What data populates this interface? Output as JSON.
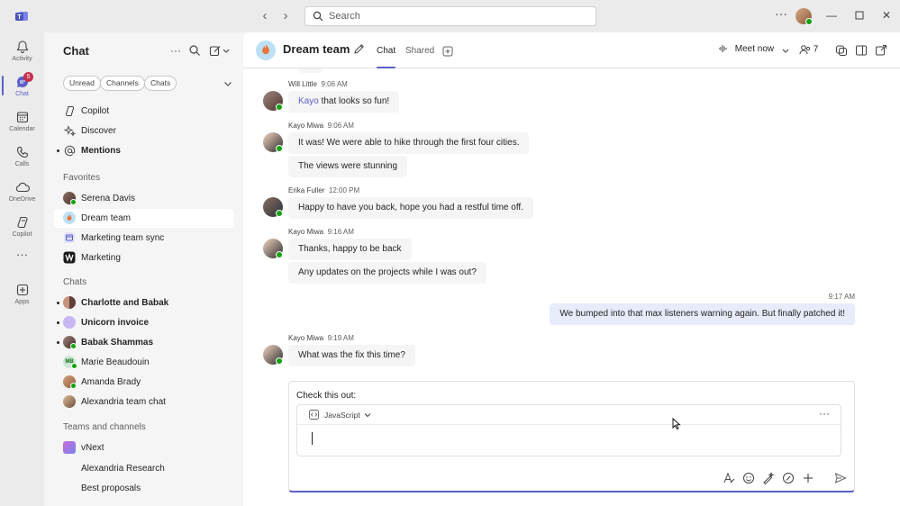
{
  "titlebar": {
    "search_placeholder": "Search"
  },
  "rail": {
    "items": [
      {
        "label": "Activity",
        "icon": "bell-icon"
      },
      {
        "label": "Chat",
        "icon": "chat-icon",
        "badge": "5"
      },
      {
        "label": "Calendar",
        "icon": "calendar-icon"
      },
      {
        "label": "Calls",
        "icon": "phone-icon"
      },
      {
        "label": "OneDrive",
        "icon": "cloud-icon"
      },
      {
        "label": "Copilot",
        "icon": "copilot-icon"
      },
      {
        "label": "Apps",
        "icon": "plus-square-icon"
      }
    ]
  },
  "chatlist": {
    "title": "Chat",
    "filters": [
      "Unread",
      "Channels",
      "Chats"
    ],
    "pinned": [
      {
        "label": "Copilot"
      },
      {
        "label": "Discover"
      },
      {
        "label": "Mentions"
      }
    ],
    "favorites_header": "Favorites",
    "favorites": [
      {
        "label": "Serena Davis"
      },
      {
        "label": "Dream team"
      },
      {
        "label": "Marketing team sync"
      },
      {
        "label": "Marketing"
      }
    ],
    "chats_header": "Chats",
    "chats": [
      {
        "label": "Charlotte and Babak"
      },
      {
        "label": "Unicorn invoice"
      },
      {
        "label": "Babak Shammas"
      },
      {
        "label": "Marie Beaudouin",
        "initials": "MB"
      },
      {
        "label": "Amanda Brady"
      },
      {
        "label": "Alexandria team chat"
      }
    ],
    "teams_header": "Teams and channels",
    "teams": [
      {
        "label": "vNext"
      },
      {
        "label": "Alexandria Research"
      },
      {
        "label": "Best proposals"
      }
    ]
  },
  "header": {
    "title": "Dream team",
    "tabs": [
      "Chat",
      "Shared"
    ],
    "meet_now": "Meet now",
    "participants": "7"
  },
  "messages": [
    {
      "author": "Will Little",
      "time": "9:06 AM",
      "mention": "Kayo",
      "text": " that looks so fun!"
    },
    {
      "author": "Kayo Miwa",
      "time": "9:06 AM",
      "text": "It was! We were able to hike through the first four cities."
    },
    {
      "text": "The views were stunning"
    },
    {
      "author": "Erika Fuller",
      "time": "12:00 PM",
      "text": "Happy to have you back, hope you had a restful time off."
    },
    {
      "author": "Kayo Miwa",
      "time": "9:16 AM",
      "text": "Thanks, happy to be back"
    },
    {
      "text": "Any updates on the projects while I was out?"
    },
    {
      "time": "9:17 AM",
      "text": "We bumped into that max listeners warning again. But finally patched it!"
    },
    {
      "author": "Kayo Miwa",
      "time": "9:19 AM",
      "text": "What was the fix this time?"
    }
  ],
  "compose": {
    "text": "Check this out:",
    "code_language": "JavaScript"
  },
  "colors": {
    "accent": "#5b5fc7",
    "presence": "#13a10e",
    "badge": "#c4314b"
  }
}
